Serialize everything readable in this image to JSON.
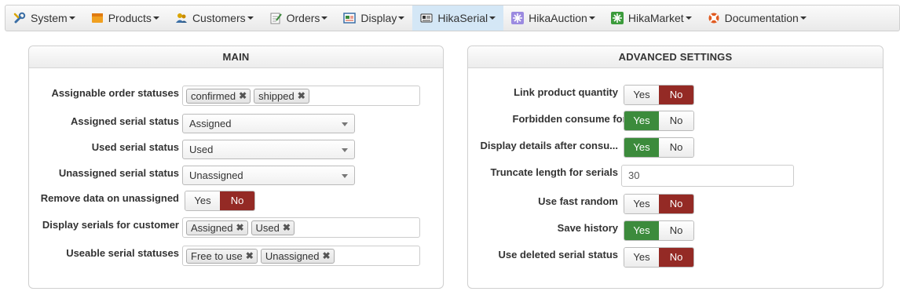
{
  "menu": [
    {
      "label": "System",
      "icon": "wrench-icon"
    },
    {
      "label": "Products",
      "icon": "box-icon"
    },
    {
      "label": "Customers",
      "icon": "users-icon"
    },
    {
      "label": "Orders",
      "icon": "clipboard-icon"
    },
    {
      "label": "Display",
      "icon": "monitor-icon"
    },
    {
      "label": "HikaSerial",
      "icon": "serial-icon"
    },
    {
      "label": "HikaAuction",
      "icon": "auction-icon"
    },
    {
      "label": "HikaMarket",
      "icon": "market-icon"
    },
    {
      "label": "Documentation",
      "icon": "lifebuoy-icon"
    }
  ],
  "main": {
    "title": "MAIN",
    "assignable_order_statuses": {
      "label": "Assignable order statuses",
      "tags": [
        "confirmed",
        "shipped"
      ]
    },
    "assigned_serial_status": {
      "label": "Assigned serial status",
      "value": "Assigned"
    },
    "used_serial_status": {
      "label": "Used serial status",
      "value": "Used"
    },
    "unassigned_serial_status": {
      "label": "Unassigned serial status",
      "value": "Unassigned"
    },
    "remove_data_on_unassigned": {
      "label": "Remove data on unassigned",
      "yes": "Yes",
      "no": "No",
      "value": "No"
    },
    "display_serials_for_customer": {
      "label": "Display serials for customer",
      "tags": [
        "Assigned",
        "Used"
      ]
    },
    "useable_serial_statuses": {
      "label": "Useable serial statuses",
      "tags": [
        "Free to use",
        "Unassigned"
      ]
    }
  },
  "advanced": {
    "title": "ADVANCED SETTINGS",
    "link_product_quantity": {
      "label": "Link product quantity",
      "yes": "Yes",
      "no": "No",
      "value": "No"
    },
    "forbidden_consume": {
      "label": "Forbidden consume for gu...",
      "yes": "Yes",
      "no": "No",
      "value": "Yes"
    },
    "display_details": {
      "label": "Display details after consu...",
      "yes": "Yes",
      "no": "No",
      "value": "Yes"
    },
    "truncate_length": {
      "label": "Truncate length for serials",
      "value": "30"
    },
    "use_fast_random": {
      "label": "Use fast random",
      "yes": "Yes",
      "no": "No",
      "value": "No"
    },
    "save_history": {
      "label": "Save history",
      "yes": "Yes",
      "no": "No",
      "value": "Yes"
    },
    "use_deleted_serial_status": {
      "label": "Use deleted serial status",
      "yes": "Yes",
      "no": "No",
      "value": "No"
    }
  },
  "colors": {
    "active_menu": "#d4e7f6",
    "yes_active": "#3c8b3c",
    "no_active": "#942a25"
  },
  "tag_remove_glyph": "✖"
}
